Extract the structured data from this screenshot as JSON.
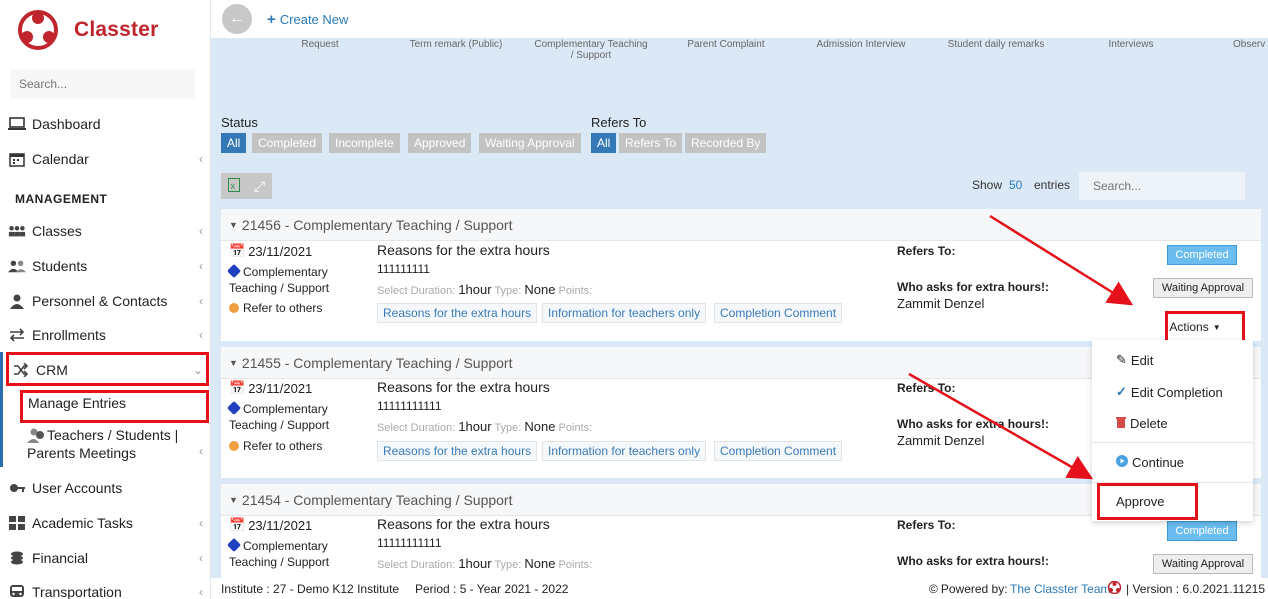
{
  "app": {
    "name": "Classter"
  },
  "sidebar": {
    "search_placeholder": "Search...",
    "section_label": "MANAGEMENT",
    "items": [
      {
        "label": "Dashboard",
        "icon": "laptop-icon"
      },
      {
        "label": "Calendar",
        "icon": "calendar-icon"
      },
      {
        "label": "Classes",
        "icon": "group-icon"
      },
      {
        "label": "Students",
        "icon": "students-icon"
      },
      {
        "label": "Personnel & Contacts",
        "icon": "person-icon"
      },
      {
        "label": "Enrollments",
        "icon": "exchange-icon"
      },
      {
        "label": "CRM",
        "icon": "shuffle-icon"
      },
      {
        "label": "User Accounts",
        "icon": "key-icon"
      },
      {
        "label": "Academic Tasks",
        "icon": "grid-icon"
      },
      {
        "label": "Financial",
        "icon": "coins-icon"
      },
      {
        "label": "Transportation",
        "icon": "bus-icon"
      }
    ],
    "crm_sub": {
      "manage_entries": "Manage Entries",
      "meetings_line1": "Teachers / Students |",
      "meetings_line2": "Parents Meetings"
    }
  },
  "topbar": {
    "create_new": "Create New"
  },
  "type_tabs": [
    "Request",
    "Term remark (Public)",
    "Complementary Teaching",
    "/ Support",
    "Parent Complaint",
    "Admission Interview",
    "Student daily remarks",
    "Interviews",
    "Observ"
  ],
  "filters": {
    "status_title": "Status",
    "status": [
      "All",
      "Completed",
      "Incomplete",
      "Approved",
      "Waiting Approval"
    ],
    "refers_title": "Refers To",
    "refers": [
      "All",
      "Refers To",
      "Recorded By"
    ]
  },
  "table_controls": {
    "show": "Show",
    "entries_count": "50",
    "entries": "entries",
    "search_placeholder": "Search..."
  },
  "entries": [
    {
      "header": "21456 - Complementary Teaching / Support",
      "date": "23/11/2021",
      "category_line1": "Complementary",
      "category_line2": "Teaching / Support",
      "refer": "Refer to others",
      "title": "Reasons for the extra hours",
      "number": "111111111",
      "duration_label": "Select Duration:",
      "duration_value": "1hour",
      "type_label": "Type:",
      "type_value": "None",
      "points_label": "Points:",
      "links": [
        "Reasons for the extra hours",
        "Information for teachers only",
        "Completion Comment"
      ],
      "refers_to": "Refers To:",
      "asks_label": "Who asks for extra hours!:",
      "asks_name": "Zammit Denzel",
      "status_badge": "Completed",
      "approval_badge": "Waiting Approval",
      "actions_label": "Actions"
    },
    {
      "header": "21455 - Complementary Teaching / Support",
      "date": "23/11/2021",
      "category_line1": "Complementary",
      "category_line2": "Teaching / Support",
      "refer": "Refer to others",
      "title": "Reasons for the extra hours",
      "number": "11111111111",
      "duration_label": "Select Duration:",
      "duration_value": "1hour",
      "type_label": "Type:",
      "type_value": "None",
      "points_label": "Points:",
      "links": [
        "Reasons for the extra hours",
        "Information for teachers only",
        "Completion Comment"
      ],
      "refers_to": "Refers To:",
      "asks_label": "Who asks for extra hours!:",
      "asks_name": "Zammit Denzel"
    },
    {
      "header": "21454 - Complementary Teaching / Support",
      "date": "23/11/2021",
      "category_line1": "Complementary",
      "category_line2": "Teaching / Support",
      "title": "Reasons for the extra hours",
      "number": "11111111111",
      "duration_label": "Select Duration:",
      "duration_value": "1hour",
      "type_label": "Type:",
      "type_value": "None",
      "points_label": "Points:",
      "refers_to": "Refers To:",
      "asks_label": "Who asks for extra hours!:",
      "status_badge": "Completed",
      "approval_badge": "Waiting Approval"
    }
  ],
  "actions_menu": {
    "edit": "Edit",
    "edit_completion": "Edit Completion",
    "delete": "Delete",
    "continue": "Continue",
    "approve": "Approve"
  },
  "footer": {
    "institute": "Institute : 27 - Demo K12 Institute",
    "period": "Period : 5 - Year 2021 - 2022",
    "powered": "Powered by:",
    "team": "The Classter Team",
    "version": "| Version : 6.0.2021.11215"
  },
  "colors": {
    "brand": "#c0252d",
    "accent": "#3479b5",
    "highlight": "#e6101a",
    "main_bg": "#dbe9f6"
  }
}
